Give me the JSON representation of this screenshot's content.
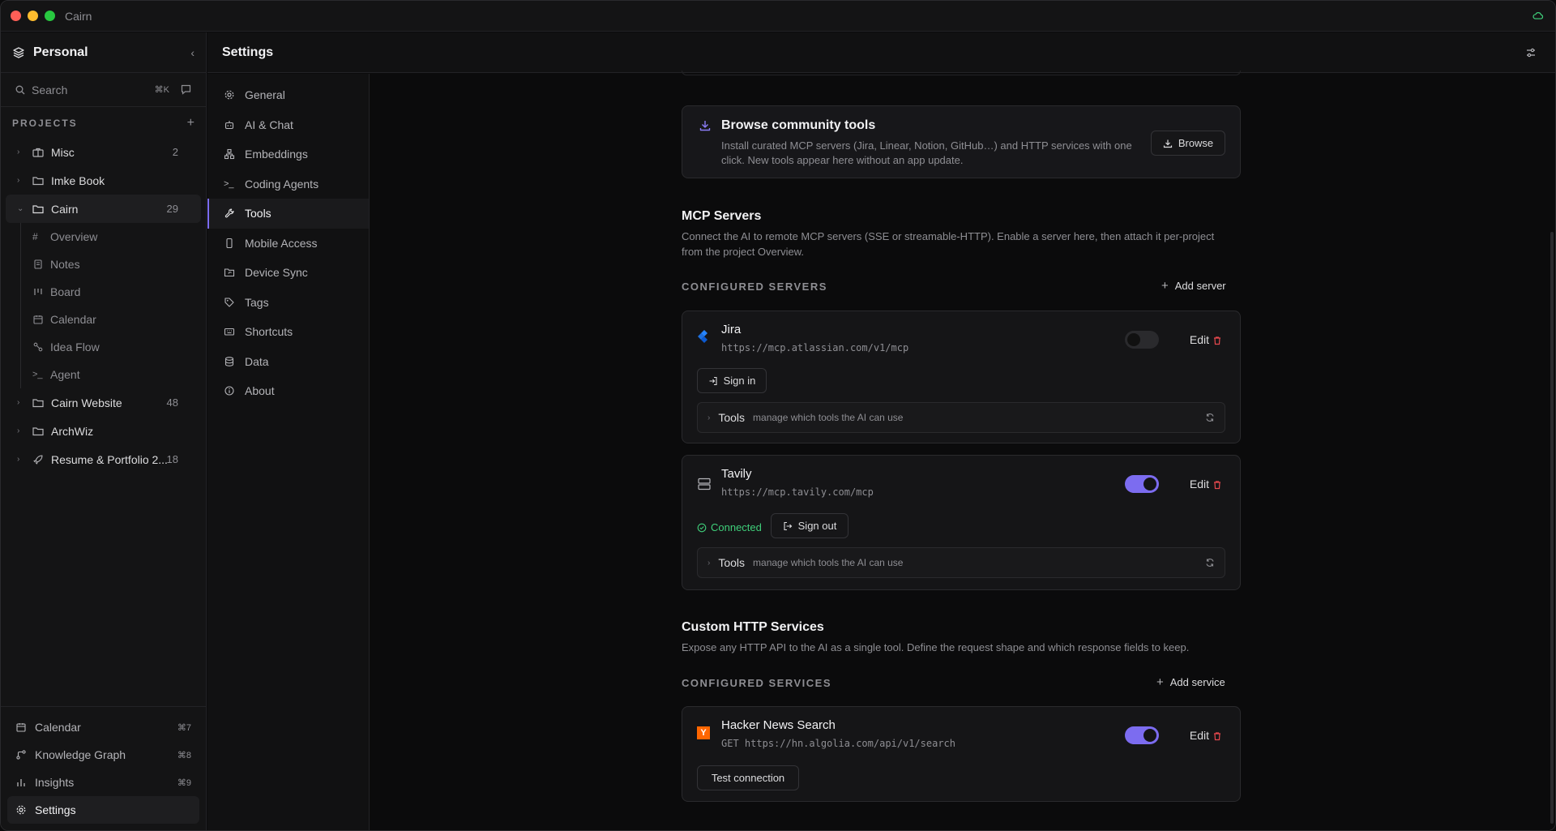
{
  "window": {
    "title": "Cairn"
  },
  "sidebar": {
    "workspace": "Personal",
    "search": {
      "label": "Search",
      "shortcut": "⌘K"
    },
    "projects_label": "PROJECTS",
    "projects": [
      {
        "name": "Misc",
        "count": "2",
        "icon": "briefcase-icon"
      },
      {
        "name": "Imke Book",
        "count": "",
        "icon": "folder-icon"
      },
      {
        "name": "Cairn",
        "count": "29",
        "icon": "folder-icon",
        "expanded": true
      }
    ],
    "cairn_children": [
      {
        "label": "Overview",
        "icon": "hash-icon"
      },
      {
        "label": "Notes",
        "icon": "note-icon"
      },
      {
        "label": "Board",
        "icon": "board-icon"
      },
      {
        "label": "Calendar",
        "icon": "calendar-icon"
      },
      {
        "label": "Idea Flow",
        "icon": "flow-icon"
      },
      {
        "label": "Agent",
        "icon": "terminal-icon"
      }
    ],
    "projects_after": [
      {
        "name": "Cairn Website",
        "count": "48",
        "icon": "folder-icon"
      },
      {
        "name": "ArchWiz",
        "count": "",
        "icon": "folder-icon"
      },
      {
        "name": "Resume & Portfolio 2...",
        "count": "18",
        "icon": "rocket-icon"
      }
    ],
    "bottom": [
      {
        "label": "Calendar",
        "shortcut": "⌘7"
      },
      {
        "label": "Knowledge Graph",
        "shortcut": "⌘8"
      },
      {
        "label": "Insights",
        "shortcut": "⌘9"
      },
      {
        "label": "Settings",
        "shortcut": ""
      }
    ]
  },
  "settings": {
    "title": "Settings",
    "nav": [
      "General",
      "AI & Chat",
      "Embeddings",
      "Coding Agents",
      "Tools",
      "Mobile Access",
      "Device Sync",
      "Tags",
      "Shortcuts",
      "Data",
      "About"
    ],
    "active_nav": "Tools"
  },
  "browse": {
    "title": "Browse community tools",
    "desc": "Install curated MCP servers (Jira, Linear, Notion, GitHub…) and HTTP services with one click. New tools appear here without an app update.",
    "button": "Browse"
  },
  "mcp": {
    "title": "MCP Servers",
    "desc": "Connect the AI to remote MCP servers (SSE or streamable-HTTP). Enable a server here, then attach it per-project from the project Overview.",
    "configured_label": "CONFIGURED SERVERS",
    "add_label": "Add server",
    "servers": [
      {
        "name": "Jira",
        "url": "https://mcp.atlassian.com/v1/mcp",
        "enabled": false,
        "edit": "Edit",
        "action": "Sign in",
        "status": "",
        "tools_label": "Tools",
        "tools_desc": "manage which tools the AI can use"
      },
      {
        "name": "Tavily",
        "url": "https://mcp.tavily.com/mcp",
        "enabled": true,
        "edit": "Edit",
        "action": "Sign out",
        "status": "Connected",
        "tools_label": "Tools",
        "tools_desc": "manage which tools the AI can use"
      }
    ]
  },
  "http": {
    "title": "Custom HTTP Services",
    "desc": "Expose any HTTP API to the AI as a single tool. Define the request shape and which response fields to keep.",
    "configured_label": "CONFIGURED SERVICES",
    "add_label": "Add service",
    "services": [
      {
        "name": "Hacker News Search",
        "method": "GET",
        "url": "https://hn.algolia.com/api/v1/search",
        "enabled": true,
        "edit": "Edit",
        "action": "Test connection",
        "icon_letter": "Y"
      }
    ]
  },
  "colors": {
    "accent": "#7c6cf0",
    "connected": "#3fcf7a",
    "danger": "#e5484d",
    "hn": "#ff6600"
  }
}
